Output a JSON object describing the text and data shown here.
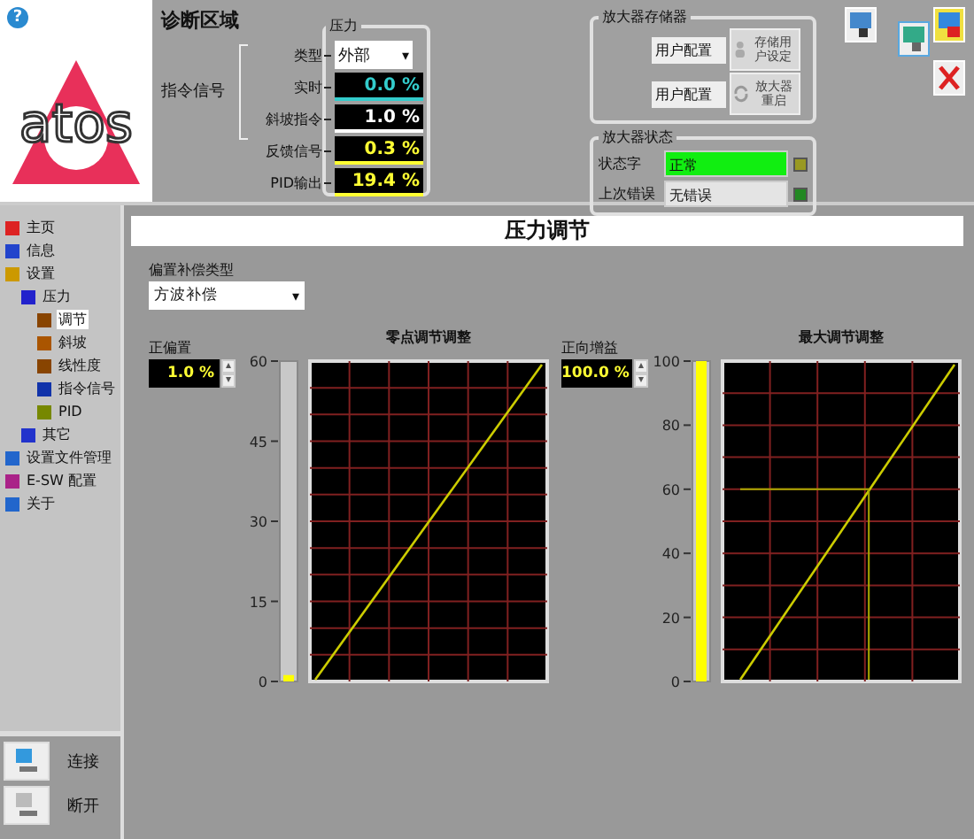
{
  "help": "?",
  "logo": "atos",
  "diagnostics": {
    "title": "诊断区域",
    "group_title": "压力",
    "bracket_label": "指令信号",
    "rows": [
      {
        "label": "类型",
        "kind": "dropdown",
        "value": "外部",
        "arrow": "▾"
      },
      {
        "label": "实时",
        "kind": "readout",
        "value": "0.0 %",
        "color": "#33cccc"
      },
      {
        "label": "斜坡指令",
        "kind": "readout",
        "value": "1.0 %",
        "color": "#ffffff"
      },
      {
        "label": "反馈信号",
        "kind": "readout",
        "value": "0.3 %",
        "color": "#ffff33"
      },
      {
        "label": "PID输出",
        "kind": "readout",
        "value": "19.4 %",
        "color": "#ffff33"
      }
    ]
  },
  "memory": {
    "title": "放大器存储器",
    "fields": [
      "用户配置",
      "用户配置"
    ],
    "buttons": [
      "存储用户设定",
      "放大器重启"
    ]
  },
  "status": {
    "title": "放大器状态",
    "rows": [
      {
        "label": "状态字",
        "value": "正常",
        "highlight": true,
        "color": "#999922"
      },
      {
        "label": "上次错误",
        "value": "无错误",
        "highlight": false,
        "color": "#228822"
      }
    ]
  },
  "sidebar": {
    "items": [
      {
        "label": "主页",
        "selected": false
      },
      {
        "label": "信息",
        "selected": false
      },
      {
        "label": "设置",
        "selected": false,
        "children": [
          {
            "label": "压力",
            "selected": false,
            "children": [
              {
                "label": "调节",
                "selected": true
              },
              {
                "label": "斜坡",
                "selected": false
              },
              {
                "label": "线性度",
                "selected": false
              },
              {
                "label": "指令信号",
                "selected": false
              },
              {
                "label": "PID",
                "selected": false
              }
            ]
          },
          {
            "label": "其它",
            "selected": false
          }
        ]
      },
      {
        "label": "设置文件管理",
        "selected": false
      },
      {
        "label": "E-SW 配置",
        "selected": false
      },
      {
        "label": "关于",
        "selected": false
      }
    ],
    "actions": [
      "连接",
      "断开"
    ]
  },
  "panel": {
    "title": "压力调节",
    "select_label": "偏置补偿类型",
    "select_value": "方波补偿",
    "select_arrow": "▾",
    "charts": [
      {
        "field_label": "正偏置",
        "field_value": "1.0 %",
        "spin": [
          "▴",
          "▾"
        ],
        "level": 0.02,
        "plot": {
          "title": "零点调节调整",
          "y_ticks": [
            "60",
            "45",
            "30",
            "15",
            "0"
          ]
        }
      },
      {
        "field_label": "正向增益",
        "field_value": "100.0 %",
        "spin": [
          "▴",
          "▾"
        ],
        "level": 1.0,
        "guide": {
          "level": 0.6
        },
        "plot": {
          "title": "最大调节调整",
          "y_ticks": [
            "100",
            "80",
            "60",
            "40",
            "20",
            "0"
          ]
        }
      }
    ]
  }
}
